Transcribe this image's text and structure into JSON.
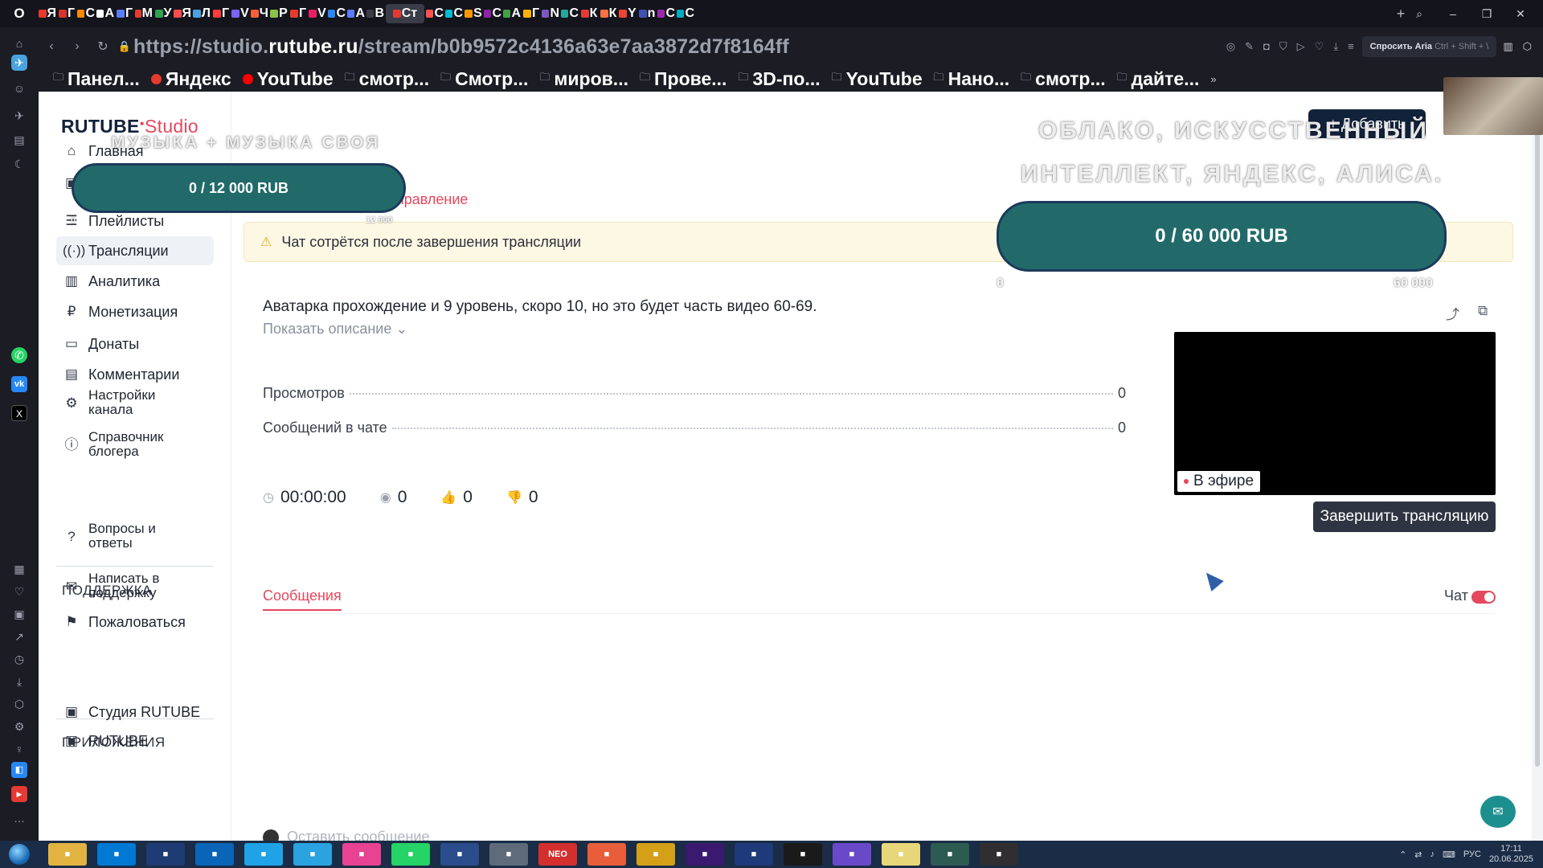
{
  "browser": {
    "url_prefix": "https://studio.",
    "url_domain": "rutube.ru",
    "url_path": "/stream/b0b9572c4136a63e7aa3872d7f8164ff",
    "aria_button": "Спросить Aria",
    "aria_shortcut": "Ctrl + Shift + \\",
    "bookmarks": [
      {
        "label": "Панел...",
        "icon": "folder-icon"
      },
      {
        "label": "Яндекс",
        "icon": "yandex-icon",
        "color": "#e63a2e"
      },
      {
        "label": "YouTube",
        "icon": "youtube-icon",
        "color": "#ff0000"
      },
      {
        "label": "смотр...",
        "icon": "folder-icon"
      },
      {
        "label": "Смотр...",
        "icon": "folder-icon"
      },
      {
        "label": "миров...",
        "icon": "folder-icon"
      },
      {
        "label": "Прове...",
        "icon": "folder-icon"
      },
      {
        "label": "3D-по...",
        "icon": "folder-icon"
      },
      {
        "label": "YouTube",
        "icon": "folder-icon"
      },
      {
        "label": "Нано...",
        "icon": "folder-icon"
      },
      {
        "label": "смотр...",
        "icon": "folder-icon"
      },
      {
        "label": "дайте...",
        "icon": "folder-icon"
      }
    ],
    "tab_letters": [
      "Я",
      "Г",
      "С",
      "А",
      "Г",
      "М",
      "У",
      "Я",
      "Л",
      "Г",
      "V",
      "Ч",
      "Р",
      "Г",
      "V",
      "С",
      "А",
      "В",
      "Ст",
      "С",
      "С",
      "S",
      "С",
      "А",
      "Г",
      "N",
      "С",
      "К",
      "К",
      "Y",
      "n",
      "С",
      "С"
    ]
  },
  "studio": {
    "logo_main": "RUTUBE",
    "logo_studio": "Studio",
    "add_button": "+ Добавить",
    "nav": [
      {
        "label": "Главная",
        "icon": "home-icon"
      },
      {
        "label": "Видео",
        "icon": "video-icon"
      },
      {
        "label": "Плейлисты",
        "icon": "playlist-icon"
      },
      {
        "label": "Трансляции",
        "icon": "broadcast-icon"
      },
      {
        "label": "Аналитика",
        "icon": "analytics-icon"
      },
      {
        "label": "Монетизация",
        "icon": "ruble-icon"
      },
      {
        "label": "Донаты",
        "icon": "wallet-icon"
      },
      {
        "label": "Комментарии",
        "icon": "comment-icon"
      },
      {
        "label": "Настройки канала",
        "icon": "gear-icon"
      },
      {
        "label": "Справочник блогера",
        "icon": "info-icon"
      }
    ],
    "support_title": "ПОДДЕРЖКА",
    "support": [
      {
        "label": "Вопросы и ответы",
        "icon": "question-icon"
      },
      {
        "label": "Написать в поддержку",
        "icon": "mail-icon"
      },
      {
        "label": "Пожаловаться",
        "icon": "flag-icon"
      }
    ],
    "apps_title": "ПРИЛОЖЕНИЯ",
    "apps": [
      {
        "label": "Студия RUTUBE",
        "icon": "rutube-studio-icon"
      },
      {
        "label": "RUTUBE",
        "icon": "rutube-icon"
      }
    ]
  },
  "stream": {
    "tab_label": "правление",
    "warning": "Чат сотрётся после завершения трансляции",
    "title": "Аватарка прохождение и 9 уровень, скоро 10, но это будет часть видео 60-69.",
    "show_description": "Показать описание",
    "stats": [
      {
        "label": "Просмотров",
        "value": "0"
      },
      {
        "label": "Сообщений в чате",
        "value": "0"
      }
    ],
    "duration": "00:00:00",
    "viewers": "0",
    "likes": "0",
    "dislikes": "0",
    "live_badge": "В эфире",
    "end_button": "Завершить трансляцию"
  },
  "chat": {
    "tab": "Сообщения",
    "toggle_label": "Чат",
    "toggle_on": true,
    "input_placeholder": "Оставить сообщение"
  },
  "overlays": {
    "music_text": "МУЗЫКА + МУЗЫКА СВОЯ",
    "cloud_line1": "ОБЛАКО, ИСКУССТВЕННЫЙ",
    "cloud_line2": "ИНТЕЛЛЕКТ, ЯНДЕКС, АЛИСА.",
    "goal_small": {
      "text": "0 / 12 000 RUB",
      "min": "0",
      "max": "12 000",
      "current": 0
    },
    "goal_large": {
      "text": "0 / 60 000 RUB",
      "min": "0",
      "max": "60 000",
      "current": 0
    }
  },
  "taskbar": {
    "apps": [
      "explorer",
      "windows",
      "malwarebytes",
      "outlook",
      "edge",
      "telegram",
      "flower",
      "whatsapp",
      "aria",
      "settings",
      "NEO",
      "browser",
      "winamp",
      "media",
      "nvidia",
      "opera",
      "vstudio",
      "notepad",
      "screen",
      "obs"
    ],
    "lang": "РУС",
    "time": "17:11",
    "date": "20.06.2025"
  },
  "colors": {
    "accent": "#e5475d",
    "dark_button": "#2e3441",
    "goal_bar": "#226a6a",
    "warning_bg": "#fdf8e4"
  }
}
